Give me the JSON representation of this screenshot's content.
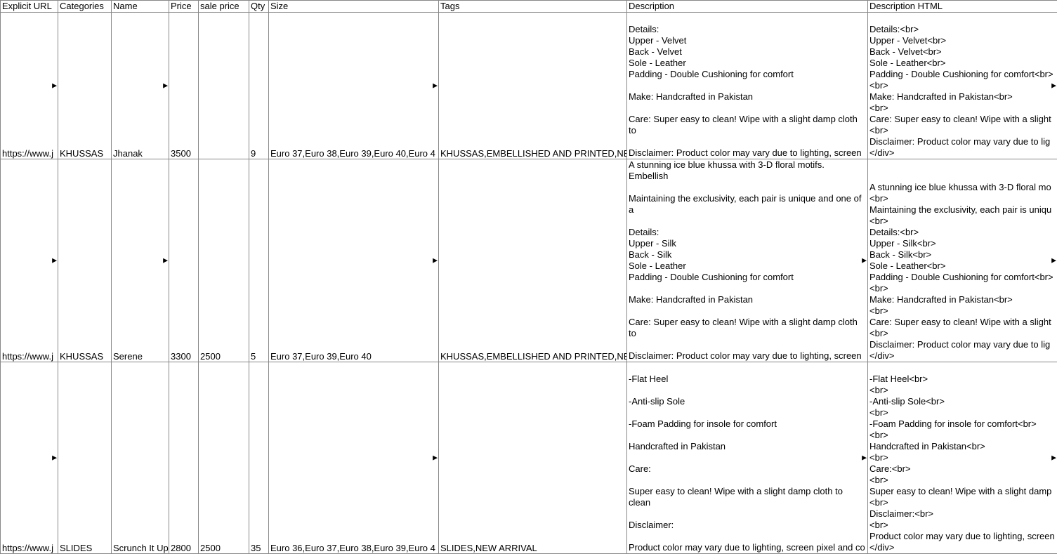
{
  "headers": {
    "url": "Explicit URL",
    "categories": "Categories",
    "name": "Name",
    "price": "Price",
    "sale": "sale price",
    "qty": "Qty",
    "size": "Size",
    "tags": "Tags",
    "desc": "Description",
    "deschtml": "Description HTML"
  },
  "rows": [
    {
      "url": "https://www.j",
      "categories": "KHUSSAS",
      "name": "Jhanak",
      "price": "3500",
      "sale": "",
      "qty": "9",
      "size": "Euro 37,Euro 38,Euro 39,Euro 40,Euro 4",
      "tags": "KHUSSAS,EMBELLISHED AND PRINTED,NE",
      "desc": "\nDetails:\nUpper - Velvet\nBack - Velvet\nSole - Leather\nPadding - Double Cushioning for comfort\n\nMake: Handcrafted in Pakistan\n\nCare: Super easy to clean! Wipe with a slight damp cloth to\n\nDisclaimer: Product color may vary due to lighting, screen",
      "deschtml": "Details:<br>\nUpper - Velvet<br>\nBack - Velvet<br>\nSole - Leather<br>\nPadding - Double Cushioning for comfort<br>\n<br>\nMake: Handcrafted in Pakistan<br>\n<br>\nCare: Super easy to clean! Wipe with a slight\n<br>\nDisclaimer: Product color may vary due to lig\n</div>"
    },
    {
      "url": "https://www.j",
      "categories": "KHUSSAS",
      "name": "Serene",
      "price": "3300",
      "sale": "2500",
      "qty": "5",
      "size": "Euro 37,Euro 39,Euro 40",
      "tags": "KHUSSAS,EMBELLISHED AND PRINTED,NE",
      "desc": "A stunning ice blue khussa with 3-D floral motifs. Embellish\n\nMaintaining the exclusivity, each pair is unique and one of a\n\nDetails:\nUpper - Silk\nBack - Silk\nSole - Leather\nPadding - Double Cushioning for comfort\n\nMake: Handcrafted in Pakistan\n\nCare: Super easy to clean! Wipe with a slight damp cloth to\n\nDisclaimer: Product color may vary due to lighting, screen",
      "deschtml": "A stunning ice blue khussa with 3-D floral mo\n<br>\nMaintaining the exclusivity, each pair is uniqu\n<br>\nDetails:<br>\nUpper - Silk<br>\nBack - Silk<br>\nSole - Leather<br>\nPadding - Double Cushioning for comfort<br>\n<br>\nMake: Handcrafted in Pakistan<br>\n<br>\nCare: Super easy to clean! Wipe with a slight\n<br>\nDisclaimer: Product color may vary due to lig\n</div>"
    },
    {
      "url": "https://www.j",
      "categories": "SLIDES",
      "name": "Scrunch It Up",
      "price": "2800",
      "sale": "2500",
      "qty": "35",
      "size": "Euro 36,Euro 37,Euro 38,Euro 39,Euro 4",
      "tags": "SLIDES,NEW ARRIVAL",
      "desc": "\n-Flat Heel\n\n-Anti-slip Sole\n\n-Foam Padding for insole for comfort\n\nHandcrafted in Pakistan\n\nCare:\n\nSuper easy to clean! Wipe with a slight damp cloth to clean\n\nDisclaimer:\n\nProduct color may vary due to lighting, screen pixel and co",
      "deschtml": "-Flat Heel<br>\n<br>\n-Anti-slip Sole<br>\n<br>\n-Foam Padding for insole for comfort<br>\n<br>\nHandcrafted in Pakistan<br>\n<br>\nCare:<br>\n<br>\nSuper easy to clean! Wipe with a slight damp\n<br>\nDisclaimer:<br>\n<br>\nProduct color may vary due to lighting, screen\n</div>"
    }
  ]
}
